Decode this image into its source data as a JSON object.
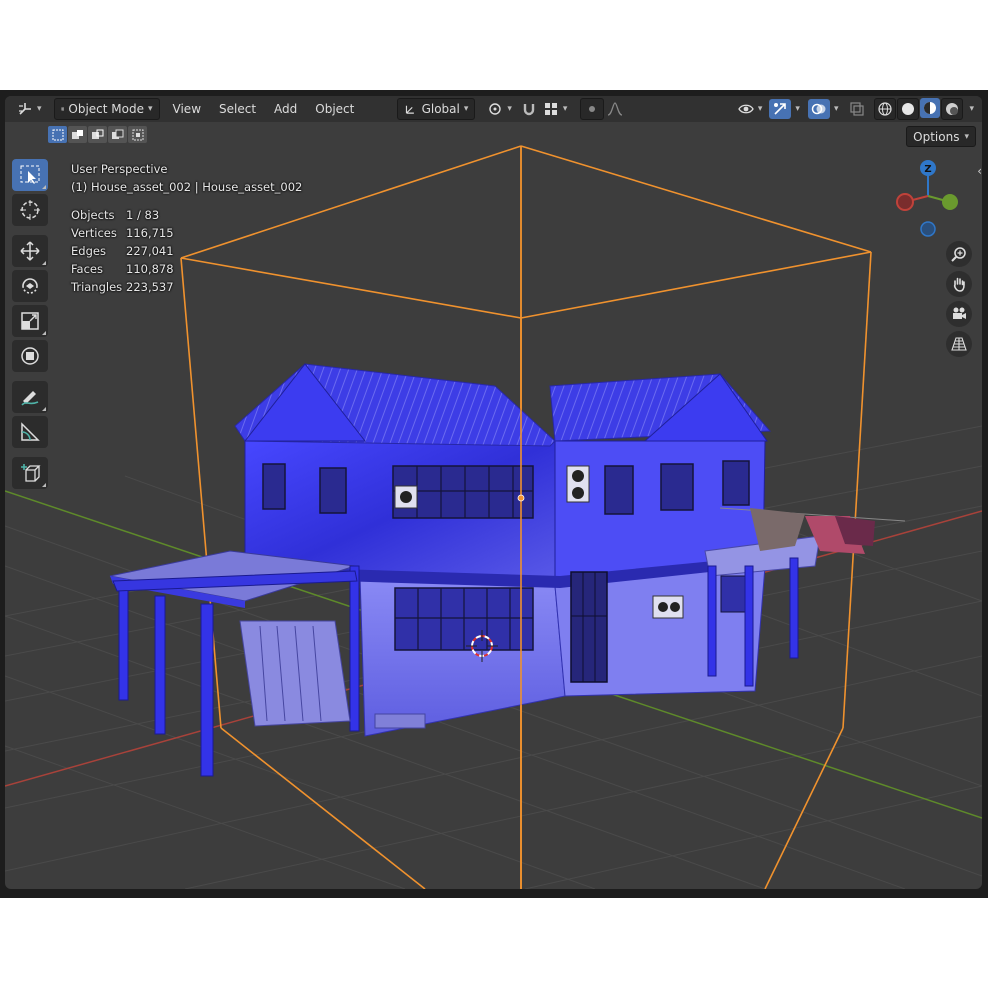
{
  "header": {
    "editor_type_icon": "axes-grid-icon",
    "mode_label": "Object Mode",
    "menus": [
      "View",
      "Select",
      "Add",
      "Object"
    ],
    "transform_orientation": "Global",
    "options_label": "Options"
  },
  "overlay": {
    "view_name": "User Perspective",
    "object_name": "(1) House_asset_002 | House_asset_002",
    "stats": [
      {
        "label": "Objects",
        "value": "1 / 83"
      },
      {
        "label": "Vertices",
        "value": "116,715"
      },
      {
        "label": "Edges",
        "value": "227,041"
      },
      {
        "label": "Faces",
        "value": "110,878"
      },
      {
        "label": "Triangles",
        "value": "223,537"
      }
    ]
  },
  "gizmo": {
    "z_label": "Z"
  },
  "tools": [
    "select-box-icon",
    "cursor-icon",
    "move-icon",
    "rotate-icon",
    "scale-icon",
    "transform-icon",
    "annotate-icon",
    "measure-icon",
    "add-cube-icon"
  ],
  "colors": {
    "viewport_bg": "#3d3d3d",
    "accent": "#4772b3",
    "selection_outline": "#f0922e",
    "x_axis": "#c0423a",
    "y_axis": "#6a9a2e",
    "z_axis": "#2f77c9",
    "house_wall": "#3a3ae8"
  }
}
